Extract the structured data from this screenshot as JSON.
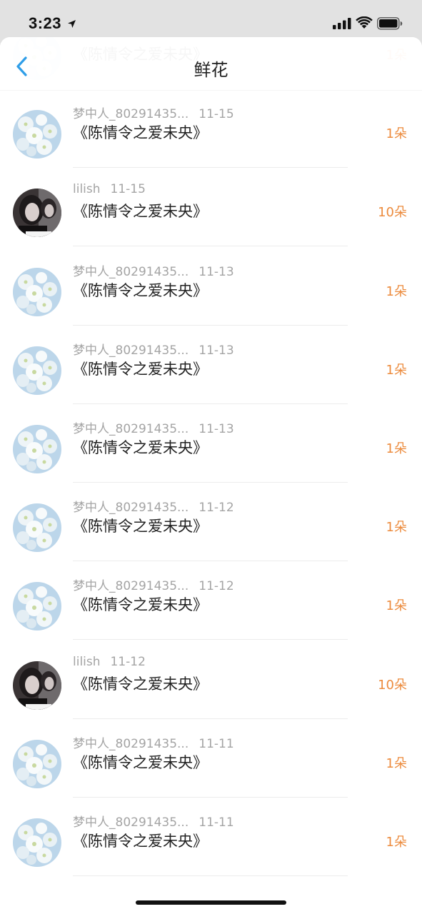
{
  "status_bar": {
    "time": "3:23",
    "icons": [
      "location-arrow-icon",
      "cellular-signal-icon",
      "wifi-icon",
      "battery-icon"
    ]
  },
  "nav": {
    "title": "鲜花",
    "back_icon": "chevron-left-icon"
  },
  "colors": {
    "accent_back": "#2f9ee8",
    "count_orange": "#ec8b3d",
    "meta_gray": "#a4a4a4"
  },
  "list": {
    "items": [
      {
        "user": "",
        "date": "",
        "title": "《陈情令之爱未央》",
        "count": "1朵",
        "avatar": "flower-avatar"
      },
      {
        "user": "梦中人_80291435...",
        "date": "11-15",
        "title": "《陈情令之爱未央》",
        "count": "1朵",
        "avatar": "flower-avatar"
      },
      {
        "user": "lilish",
        "date": "11-15",
        "title": "《陈情令之爱未央》",
        "count": "10朵",
        "avatar": "portrait-avatar"
      },
      {
        "user": "梦中人_80291435...",
        "date": "11-13",
        "title": "《陈情令之爱未央》",
        "count": "1朵",
        "avatar": "flower-avatar"
      },
      {
        "user": "梦中人_80291435...",
        "date": "11-13",
        "title": "《陈情令之爱未央》",
        "count": "1朵",
        "avatar": "flower-avatar"
      },
      {
        "user": "梦中人_80291435...",
        "date": "11-13",
        "title": "《陈情令之爱未央》",
        "count": "1朵",
        "avatar": "flower-avatar"
      },
      {
        "user": "梦中人_80291435...",
        "date": "11-12",
        "title": "《陈情令之爱未央》",
        "count": "1朵",
        "avatar": "flower-avatar"
      },
      {
        "user": "梦中人_80291435...",
        "date": "11-12",
        "title": "《陈情令之爱未央》",
        "count": "1朵",
        "avatar": "flower-avatar"
      },
      {
        "user": "lilish",
        "date": "11-12",
        "title": "《陈情令之爱未央》",
        "count": "10朵",
        "avatar": "portrait-avatar"
      },
      {
        "user": "梦中人_80291435...",
        "date": "11-11",
        "title": "《陈情令之爱未央》",
        "count": "1朵",
        "avatar": "flower-avatar"
      },
      {
        "user": "梦中人_80291435...",
        "date": "11-11",
        "title": "《陈情令之爱未央》",
        "count": "1朵",
        "avatar": "flower-avatar"
      }
    ]
  }
}
